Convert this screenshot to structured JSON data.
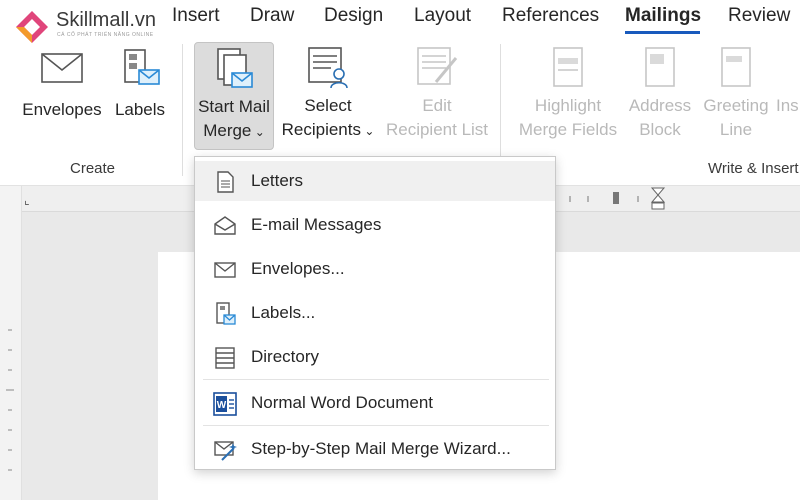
{
  "logo": {
    "brand": "Skillmall.vn",
    "tagline": "CÁ CỐ PHÁT TRIỂN NĂNG ONLINE"
  },
  "tabs": [
    {
      "label": "Insert"
    },
    {
      "label": "Draw"
    },
    {
      "label": "Design"
    },
    {
      "label": "Layout"
    },
    {
      "label": "References"
    },
    {
      "label": "Mailings",
      "active": true
    },
    {
      "label": "Review"
    }
  ],
  "ribbon": {
    "create_group": "Create",
    "write_group": "Write & Insert",
    "envelopes": "Envelopes",
    "labels": "Labels",
    "start_mail_1": "Start Mail",
    "start_mail_2": "Merge",
    "select_recipients_1": "Select",
    "select_recipients_2": "Recipients",
    "edit_list_1": "Edit",
    "edit_list_2": "Recipient List",
    "highlight_1": "Highlight",
    "highlight_2": "Merge Fields",
    "address_1": "Address",
    "address_2": "Block",
    "greeting_1": "Greeting",
    "greeting_2": "Line",
    "insert_partial": "Ins"
  },
  "menu": {
    "items": [
      {
        "label": "Letters",
        "icon": "letter-icon"
      },
      {
        "label": "E-mail Messages",
        "icon": "email-icon"
      },
      {
        "label": "Envelopes...",
        "icon": "envelope-icon"
      },
      {
        "label": "Labels...",
        "icon": "label-icon"
      },
      {
        "label": "Directory",
        "icon": "directory-icon"
      },
      {
        "label": "Normal Word Document",
        "icon": "word-icon"
      },
      {
        "label": "Step-by-Step Mail Merge Wizard...",
        "icon": "wizard-icon"
      }
    ]
  },
  "colors": {
    "accent": "#185abd",
    "hover": "#f0f0f0",
    "logo_pink": "#e0457b",
    "logo_orange": "#f39a2b"
  }
}
